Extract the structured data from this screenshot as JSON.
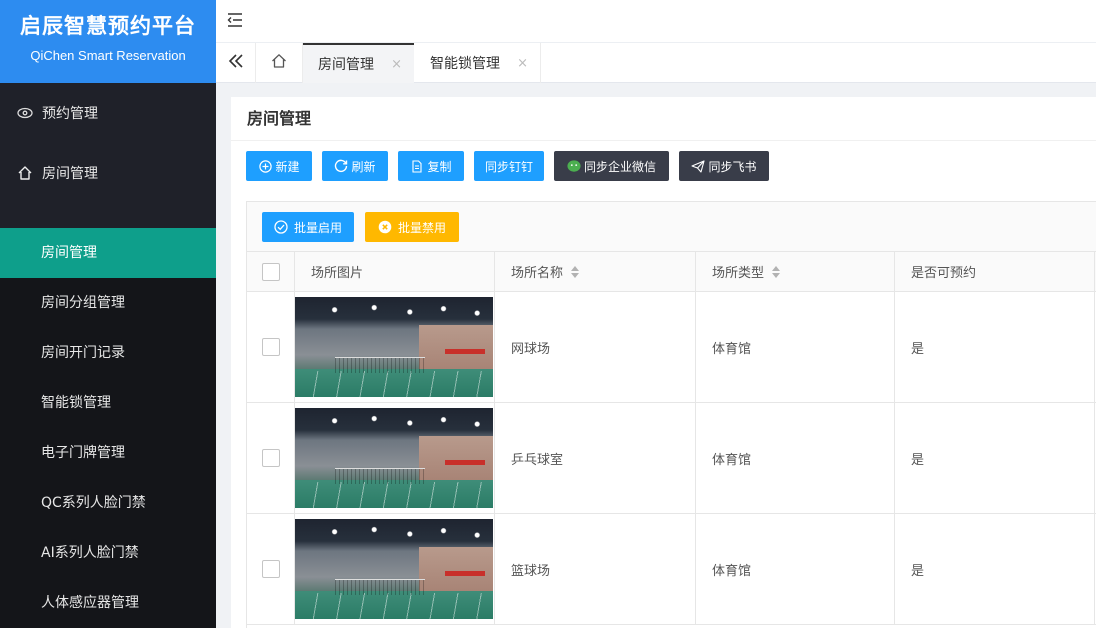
{
  "brand": {
    "title": "启辰智慧预约平台",
    "subtitle": "QiChen Smart Reservation",
    "color": "#2d8cf0"
  },
  "sidebar": {
    "groups": [
      {
        "label": "预约管理",
        "icon": "eye-icon"
      },
      {
        "label": "房间管理",
        "icon": "home-icon"
      }
    ],
    "items": [
      {
        "label": "房间管理",
        "active": true
      },
      {
        "label": "房间分组管理"
      },
      {
        "label": "房间开门记录"
      },
      {
        "label": "智能锁管理"
      },
      {
        "label": "电子门牌管理"
      },
      {
        "label": "QC系列人脸门禁"
      },
      {
        "label": "AI系列人脸门禁"
      },
      {
        "label": "人体感应器管理"
      }
    ],
    "active_color": "#0e9f8b"
  },
  "tabs": [
    {
      "label": "房间管理",
      "close": "×"
    },
    {
      "label": "智能锁管理",
      "close": "×"
    }
  ],
  "page": {
    "title": "房间管理"
  },
  "toolbar": {
    "new": "新建",
    "refresh": "刷新",
    "copy": "复制",
    "dingtalk": "同步钉钉",
    "wechat": "同步企业微信",
    "feishu": "同步飞书"
  },
  "batch": {
    "enable": "批量启用",
    "disable": "批量禁用"
  },
  "table": {
    "headers": {
      "image": "场所图片",
      "name": "场所名称",
      "type": "场所类型",
      "bookable": "是否可预约"
    },
    "rows": [
      {
        "name": "网球场",
        "type": "体育馆",
        "bookable": "是"
      },
      {
        "name": "乒乓球室",
        "type": "体育馆",
        "bookable": "是"
      },
      {
        "name": "篮球场",
        "type": "体育馆",
        "bookable": "是"
      }
    ]
  }
}
